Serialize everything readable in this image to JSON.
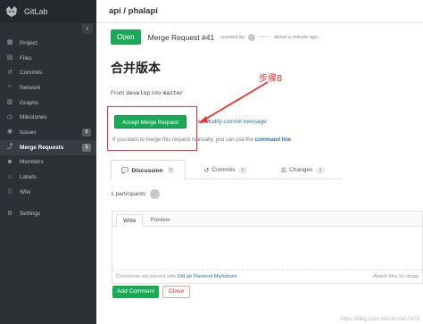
{
  "sidebar": {
    "brand": "GitLab",
    "collapse_icon": "chevron-left",
    "items": [
      {
        "label": "Project",
        "icon": "dashboard-icon"
      },
      {
        "label": "Files",
        "icon": "files-icon"
      },
      {
        "label": "Commits",
        "icon": "history-icon"
      },
      {
        "label": "Network",
        "icon": "network-icon"
      },
      {
        "label": "Graphs",
        "icon": "graphs-icon"
      },
      {
        "label": "Milestones",
        "icon": "clock-icon"
      },
      {
        "label": "Issues",
        "icon": "issues-icon",
        "count": "0"
      },
      {
        "label": "Merge Requests",
        "icon": "merge-icon",
        "count": "1",
        "active": true
      },
      {
        "label": "Members",
        "icon": "members-icon"
      },
      {
        "label": "Labels",
        "icon": "tags-icon"
      },
      {
        "label": "Wiki",
        "icon": "book-icon"
      },
      {
        "label": "Settings",
        "icon": "cogs-icon"
      }
    ]
  },
  "topbar": {
    "breadcrumb": "api / phalapi"
  },
  "mr": {
    "status": "Open",
    "title": "Merge Request #41",
    "created_by": "created by",
    "author": "~~~~",
    "time": "about a minute ago",
    "heading": "合并版本",
    "from_label": "From",
    "source_branch": "develop",
    "into_label": "into",
    "target_branch": "master"
  },
  "accept": {
    "button": "Accept Merge Request",
    "modify_link": "Modify commit message",
    "manual_prefix": "If you want to merge this request manually, you can use the",
    "manual_link": "command line"
  },
  "tabs": [
    {
      "label": "Discussion",
      "count": "0",
      "icon": "comments-icon",
      "selected": true
    },
    {
      "label": "Commits",
      "count": "1",
      "icon": "history-icon"
    },
    {
      "label": "Changes",
      "count": "1",
      "icon": "list-icon"
    }
  ],
  "participants": {
    "label": "1 participants"
  },
  "editor": {
    "write_tab": "Write",
    "preview_tab": "Preview",
    "footer_prefix": "Comments are parsed with",
    "footer_link": "GitLab Flavored Markdown",
    "attach": "Attach files by dragg"
  },
  "actions": {
    "add_comment": "Add Comment",
    "close": "Close"
  },
  "annotation": {
    "text": "步骤8",
    "color": "#e33333"
  },
  "watermark": "https://blog.csdn.net/u010417470",
  "colors": {
    "sidebar_bg": "#2d3035",
    "accent_green": "#1aaa55",
    "link_blue": "#2f6fb0"
  }
}
